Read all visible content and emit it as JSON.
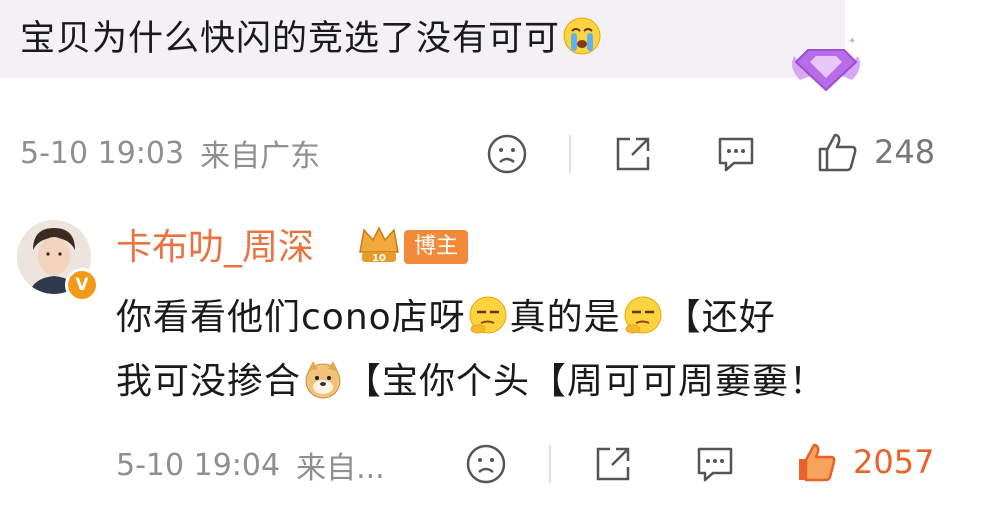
{
  "parent": {
    "text": "宝贝为什么快闪的竞选了没有可可",
    "emoji": "crying-face",
    "time": "5-10 19:03",
    "location": "来自广东",
    "likes": "248"
  },
  "reply": {
    "username": "卡布叻_周深",
    "role_tag": "博主",
    "level": "10",
    "verified_mark": "V",
    "line1_a": "你看看他们cono店呀",
    "line1_b": "真的是",
    "line1_c": "【还好",
    "line2_a": "我可没掺合",
    "line2_b": "【宝你个头【周可可周嫑嫑！",
    "time": "5-10 19:04",
    "location": "来自...",
    "likes": "2057"
  },
  "colors": {
    "accent": "#eb7340",
    "like_active": "#e8622a",
    "meta": "#8f8f8f"
  }
}
